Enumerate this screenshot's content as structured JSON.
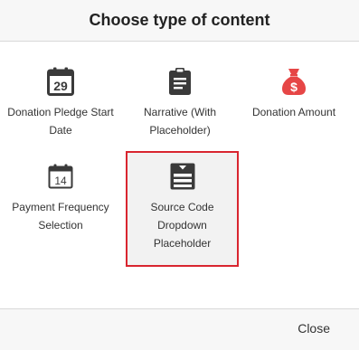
{
  "dialog": {
    "title": "Choose type of content",
    "close_label": "Close",
    "accent_color": "#d9252f",
    "items": [
      {
        "label": "Donation Pledge Start Date",
        "icon": "calendar-29-icon",
        "icon_text": "29"
      },
      {
        "label": "Narrative (With Placeholder)",
        "icon": "clipboard-icon"
      },
      {
        "label": "Donation Amount",
        "icon": "money-bag-icon",
        "icon_text": "$"
      },
      {
        "label": "Payment Frequency Selection",
        "icon": "calendar-14-icon",
        "icon_text": "14"
      },
      {
        "label": "Source Code Dropdown Placeholder",
        "icon": "dropdown-list-icon",
        "selected": true
      }
    ]
  }
}
